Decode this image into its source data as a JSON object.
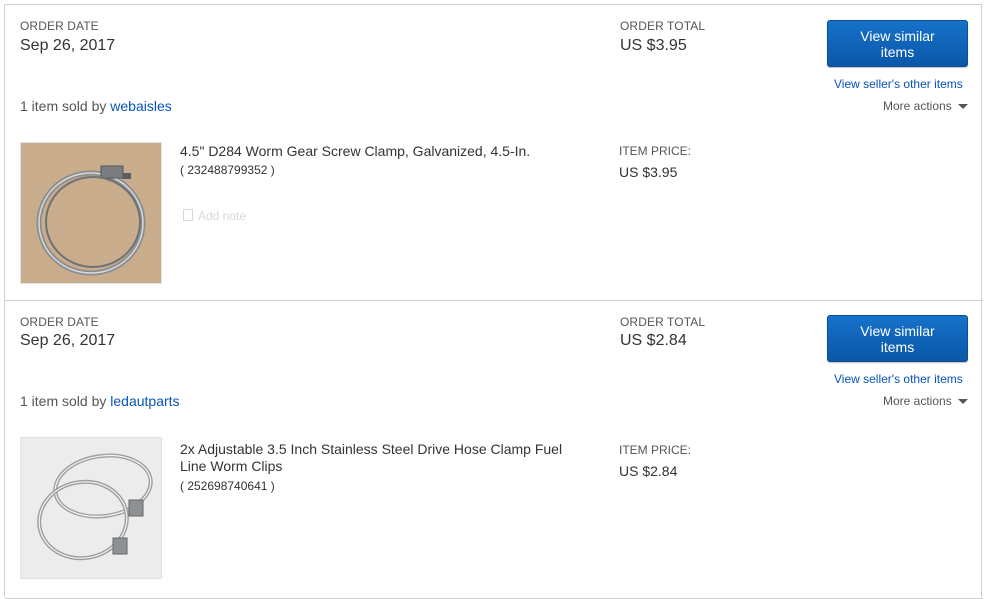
{
  "orders": [
    {
      "order_date_label": "ORDER DATE",
      "order_date": "Sep 26, 2017",
      "order_total_label": "ORDER TOTAL",
      "order_total": "US $3.95",
      "view_similar_label": "View similar items",
      "view_seller_label": "View seller's other items",
      "more_actions_label": "More actions",
      "sold_by_prefix": "1 item sold by",
      "seller": "webaisles",
      "item": {
        "title": "4.5\" D284 Worm Gear Screw Clamp, Galvanized, 4.5-In.",
        "item_number": "( 232488799352 )",
        "add_note_label": "Add note",
        "price_label": "ITEM PRICE:",
        "price": "US $3.95"
      }
    },
    {
      "order_date_label": "ORDER DATE",
      "order_date": "Sep 26, 2017",
      "order_total_label": "ORDER TOTAL",
      "order_total": "US $2.84",
      "view_similar_label": "View similar items",
      "view_seller_label": "View seller's other items",
      "more_actions_label": "More actions",
      "sold_by_prefix": "1 item sold by",
      "seller": "ledautparts",
      "item": {
        "title": "2x Adjustable 3.5 Inch Stainless Steel Drive Hose Clamp Fuel Line Worm Clips",
        "item_number": "( 252698740641 )",
        "price_label": "ITEM PRICE:",
        "price": "US $2.84"
      }
    }
  ],
  "colors": {
    "link": "#0654ba",
    "button": "#0a63b8",
    "border": "#cfcfcf"
  }
}
